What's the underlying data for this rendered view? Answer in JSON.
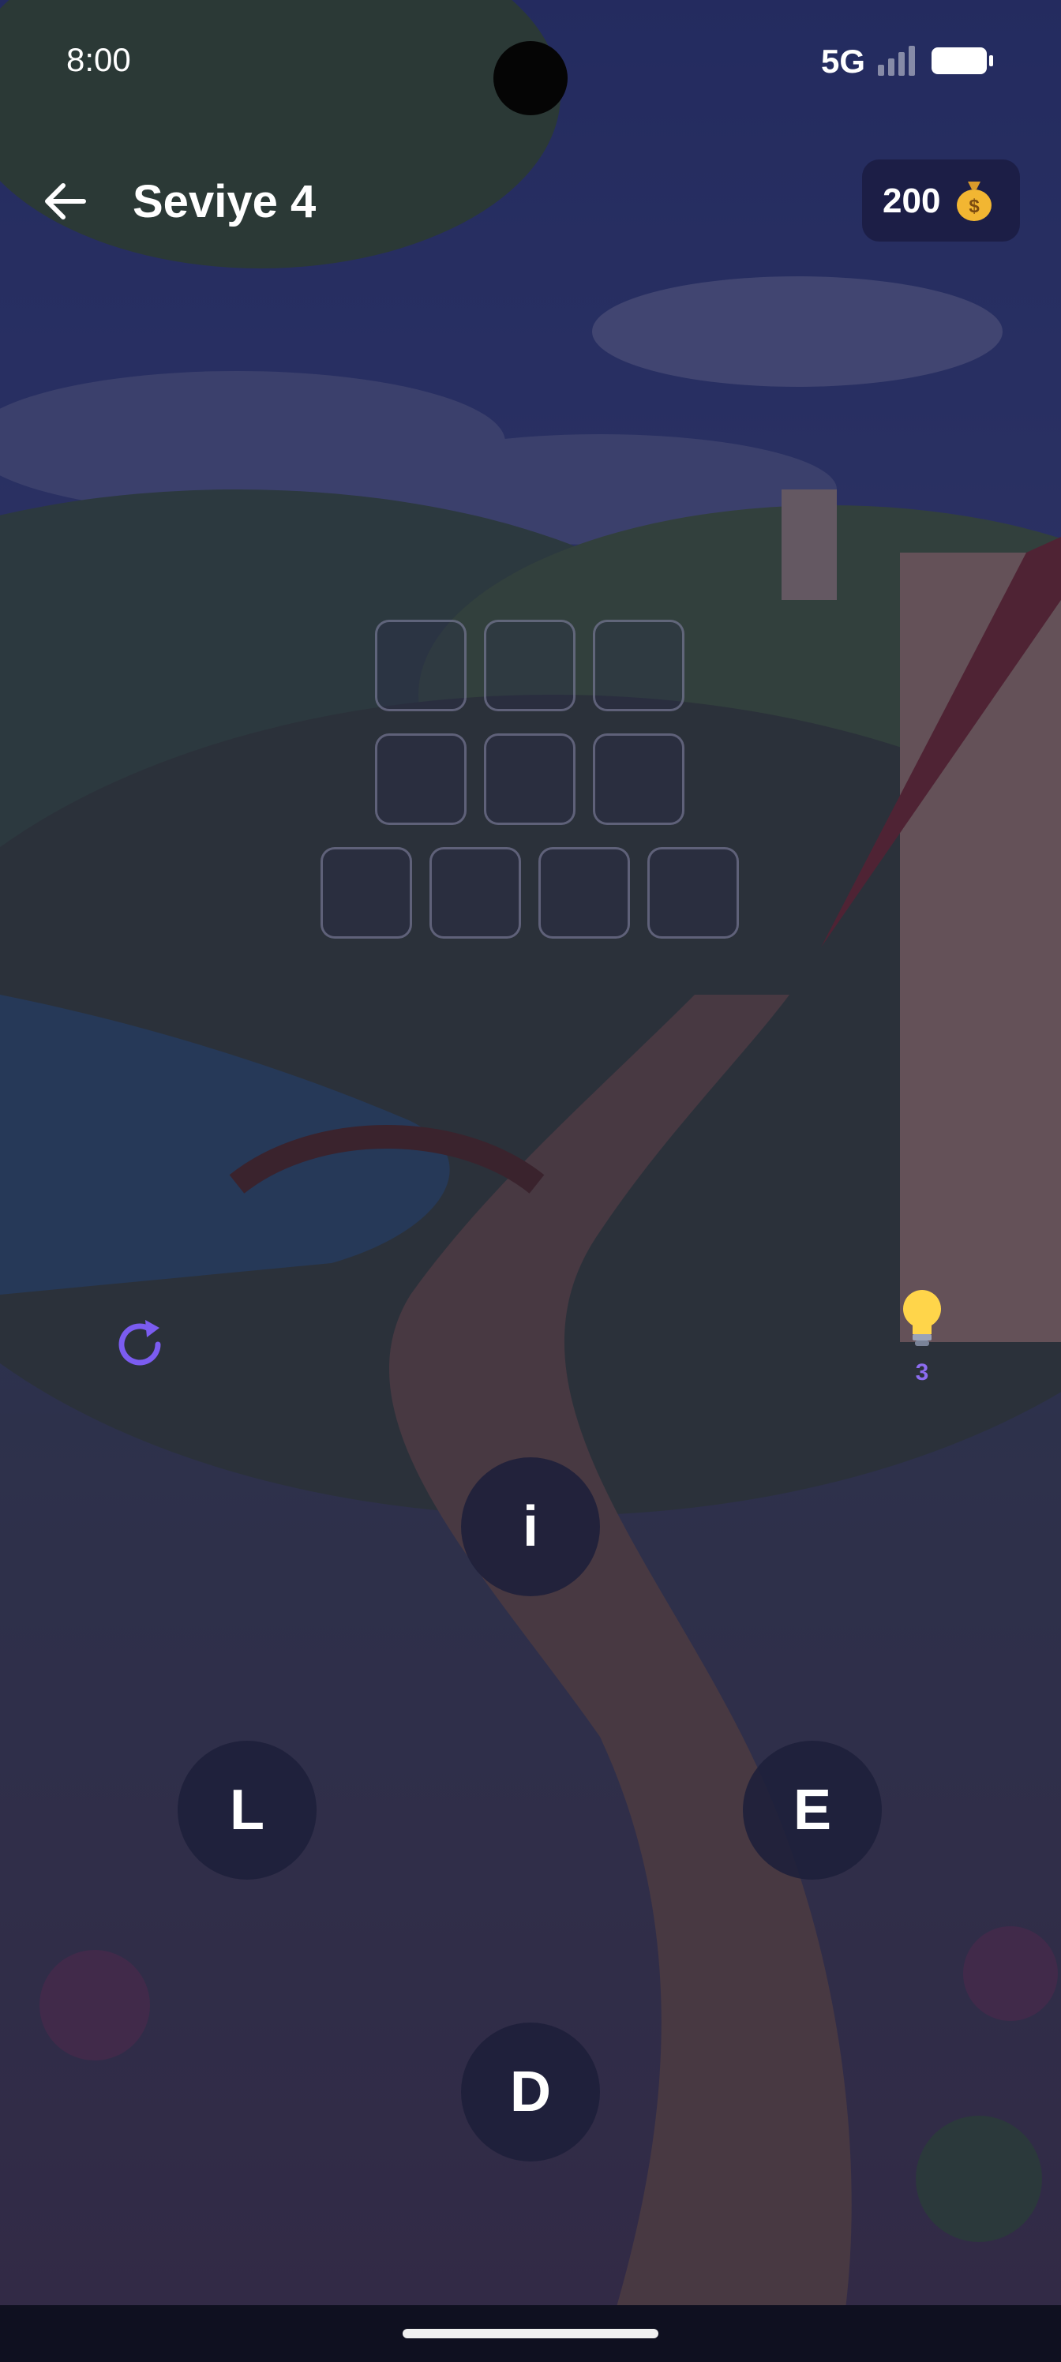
{
  "status_bar": {
    "time": "8:00",
    "network": "5G"
  },
  "header": {
    "back_icon": "arrow-left-icon",
    "title": "Seviye 4",
    "coins": "200",
    "coin_icon": "money-bag-icon"
  },
  "board": {
    "rows": [
      {
        "cells": [
          "",
          "",
          ""
        ]
      },
      {
        "cells": [
          "",
          "",
          ""
        ]
      },
      {
        "cells": [
          "",
          "",
          "",
          ""
        ]
      }
    ]
  },
  "controls": {
    "shuffle_icon": "refresh-icon",
    "hint_icon": "lightbulb-icon",
    "hint_count": "3"
  },
  "letters": [
    "i",
    "L",
    "E",
    "D"
  ],
  "colors": {
    "accent": "#7b5cf0",
    "hint_count": "#8c6cf0",
    "letter_bg": "#1c1e3a",
    "overlay": "#121030"
  }
}
